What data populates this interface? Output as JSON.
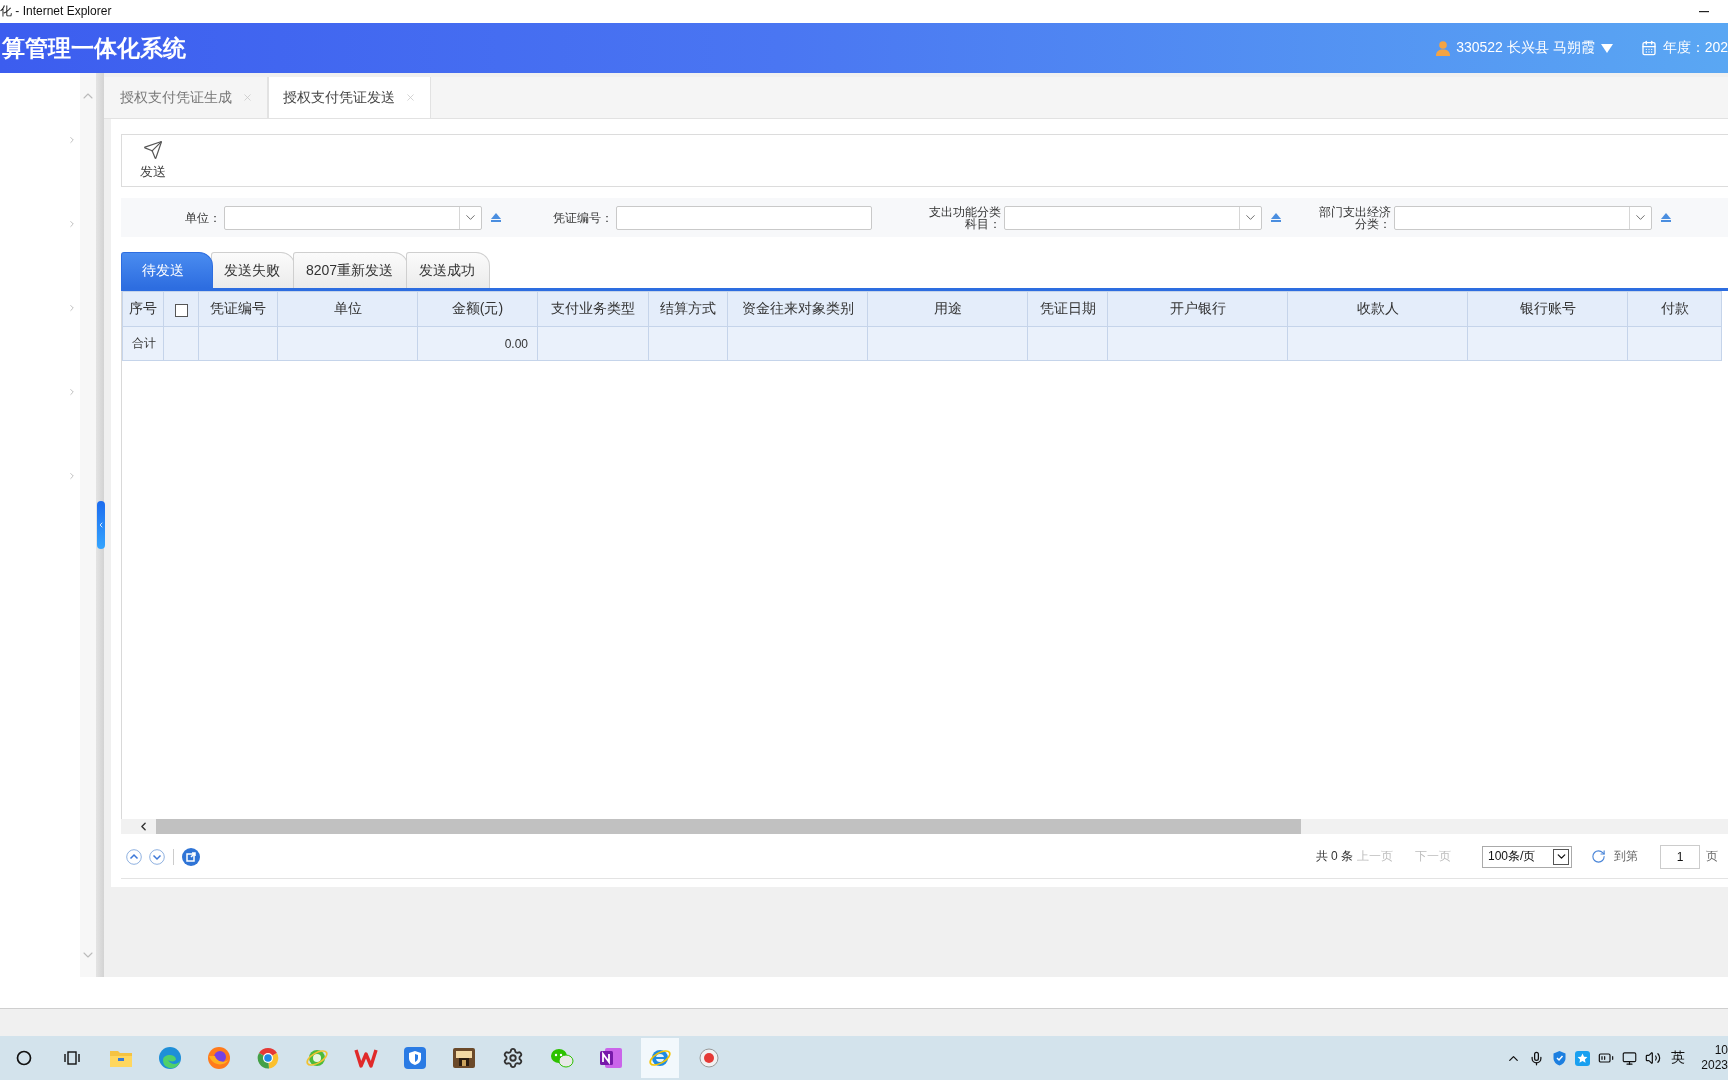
{
  "window": {
    "title": "化 - Internet Explorer"
  },
  "header": {
    "title": "算管理一体化系统",
    "user": "330522 长兴县 马朔霞",
    "year": "年度：202"
  },
  "sidebar": {
    "items": [
      {
        "expandable": true
      },
      {
        "expandable": true
      },
      {
        "expandable": true
      },
      {
        "expandable": true
      },
      {
        "expandable": true
      }
    ]
  },
  "open_tabs": [
    {
      "label": "授权支付凭证生成",
      "selected": false
    },
    {
      "label": "授权支付凭证发送",
      "selected": true
    }
  ],
  "toolbar": {
    "buttons": [
      {
        "label": "发送"
      }
    ]
  },
  "filters": [
    {
      "label": "单位：",
      "kind": "select"
    },
    {
      "label": "凭证编号：",
      "kind": "text"
    },
    {
      "label": "支出功能分类科目：",
      "kind": "select"
    },
    {
      "label": "部门支出经济分类：",
      "kind": "select"
    }
  ],
  "status_tabs": [
    {
      "label": "待发送",
      "selected": true
    },
    {
      "label": "发送失败",
      "selected": false
    },
    {
      "label": "8207重新发送",
      "selected": false
    },
    {
      "label": "发送成功",
      "selected": false
    }
  ],
  "table": {
    "columns": [
      {
        "kind": "text",
        "label": "序号",
        "total": "合计"
      },
      {
        "kind": "checkbox",
        "checked": false
      },
      {
        "kind": "text",
        "label": "凭证编号"
      },
      {
        "kind": "text",
        "label": "单位"
      },
      {
        "kind": "amount",
        "label": "金额(元)",
        "total": "0.00"
      },
      {
        "kind": "text",
        "label": "支付业务类型"
      },
      {
        "kind": "text",
        "label": "结算方式"
      },
      {
        "kind": "text",
        "label": "资金往来对象类别"
      },
      {
        "kind": "text",
        "label": "用途"
      },
      {
        "kind": "text",
        "label": "凭证日期"
      },
      {
        "kind": "text",
        "label": "开户银行"
      },
      {
        "kind": "text",
        "label": "收款人"
      },
      {
        "kind": "text",
        "label": "银行账号"
      },
      {
        "kind": "text",
        "label": "付款"
      }
    ]
  },
  "pagination": {
    "total": "共 0 条",
    "prev": {
      "label": "上一页",
      "disabled": true
    },
    "next": {
      "label": "下一页",
      "disabled": true
    },
    "page_size": "100条/页",
    "goto": "到第",
    "page": "1",
    "page_unit": "页"
  },
  "taskbar": {
    "items": [
      {
        "kind": "ring",
        "active": false
      },
      {
        "kind": "task_view",
        "active": false
      },
      {
        "kind": "folder",
        "active": false
      },
      {
        "kind": "swirl",
        "active": false
      },
      {
        "kind": "orb",
        "active": false
      },
      {
        "kind": "segmented",
        "active": false
      },
      {
        "kind": "orbit_green",
        "active": false
      },
      {
        "kind": "zigzag",
        "active": false
      },
      {
        "kind": "shield_tile",
        "active": false
      },
      {
        "kind": "picture_tile",
        "active": false
      },
      {
        "kind": "gear",
        "active": false
      },
      {
        "kind": "chat",
        "active": false
      },
      {
        "kind": "notebook",
        "active": false
      },
      {
        "kind": "orbit_blue",
        "active": true
      },
      {
        "kind": "record",
        "active": false
      }
    ],
    "ime": "英",
    "time": "10",
    "date": "2023"
  }
}
